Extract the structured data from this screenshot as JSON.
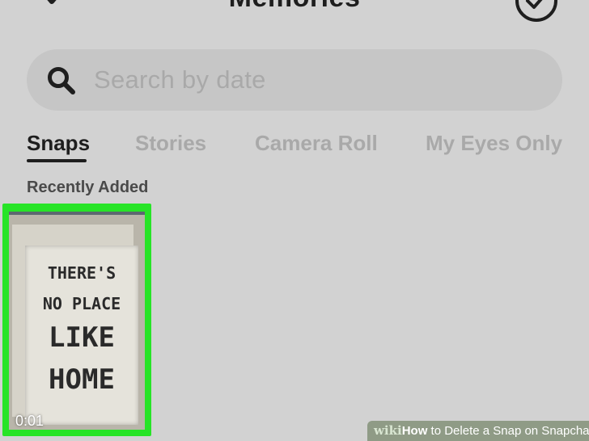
{
  "header": {
    "title": "Memories"
  },
  "search": {
    "placeholder": "Search by date"
  },
  "tabs": [
    {
      "label": "Snaps",
      "active": true
    },
    {
      "label": "Stories",
      "active": false
    },
    {
      "label": "Camera Roll",
      "active": false
    },
    {
      "label": "My Eyes Only",
      "active": false
    }
  ],
  "section": {
    "title": "Recently Added"
  },
  "snap": {
    "duration": "0:01",
    "sign_lines": [
      "THERE'S",
      "NO PLACE",
      "LIKE",
      "HOME"
    ],
    "highlight_color": "#27e427"
  },
  "watermark": {
    "brand": "wiki",
    "how": "How",
    "rest": " to Delete a Snap on Snapchat"
  },
  "colors": {
    "background": "#d2d2d2",
    "active_text": "#1e1e1e",
    "inactive_text": "#a9a9a9"
  }
}
